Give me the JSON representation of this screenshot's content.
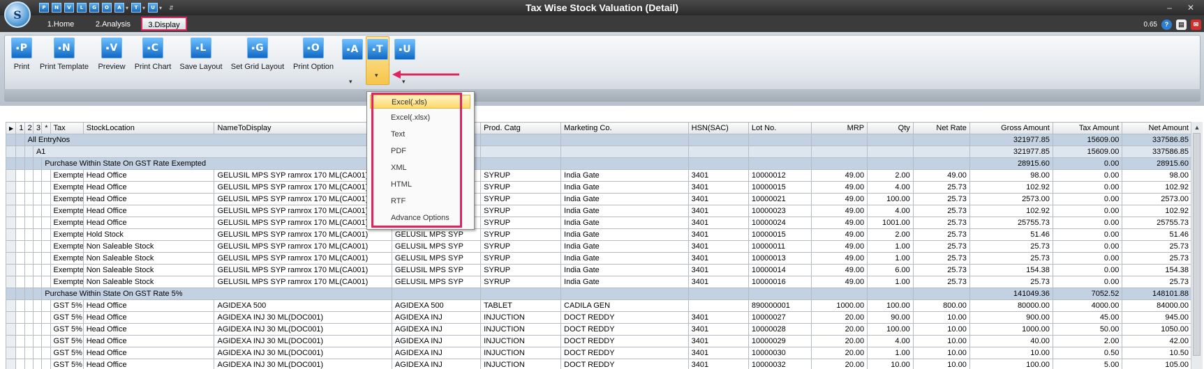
{
  "window": {
    "title": "Tax Wise Stock Valuation (Detail)"
  },
  "quick_access": [
    "P",
    "N",
    "V",
    "L",
    "G",
    "O",
    "A",
    "T",
    "U"
  ],
  "tabs": [
    {
      "label": "1.Home"
    },
    {
      "label": "2.Analysis"
    },
    {
      "label": "3.Display"
    }
  ],
  "status": {
    "zoom": "0.65"
  },
  "ribbon": {
    "buttons": [
      {
        "letter": "P",
        "label": "Print"
      },
      {
        "letter": "N",
        "label": "Print Template"
      },
      {
        "letter": "V",
        "label": "Preview"
      },
      {
        "letter": "C",
        "label": "Print Chart"
      },
      {
        "letter": "L",
        "label": "Save Layout"
      },
      {
        "letter": "G",
        "label": "Set Grid Layout"
      },
      {
        "letter": "O",
        "label": "Print Option"
      }
    ],
    "small_buttons": [
      {
        "letter": "A"
      },
      {
        "letter": "T"
      },
      {
        "letter": "U"
      }
    ]
  },
  "export_menu": {
    "items": [
      "Excel(.xls)",
      "Excel(.xlsx)",
      "Text",
      "PDF",
      "XML",
      "HTML",
      "RTF",
      "Advance Options"
    ]
  },
  "grid": {
    "headers": [
      "1",
      "2",
      "3",
      "*",
      "Tax",
      "StockLocation",
      "NameToDisplay",
      "",
      "Prod. Catg",
      "Marketing Co.",
      "HSN(SAC)",
      "Lot No.",
      "MRP",
      "Qty",
      "Net Rate",
      "Gross Amount",
      "Tax Amount",
      "Net Amount"
    ],
    "all_entry": {
      "label": "All EntryNos",
      "gross": "321977.85",
      "tax": "15609.00",
      "net": "337586.85"
    },
    "a1": {
      "label": "A1",
      "gross": "321977.85",
      "tax": "15609.00",
      "net": "337586.85"
    },
    "group1": {
      "label": "Purchase Within State On GST Rate Exempted",
      "gross": "28915.60",
      "tax": "0.00",
      "net": "28915.60"
    },
    "rows1": [
      [
        "Exempted",
        "Head Office",
        "GELUSIL MPS SYP ramrox 170 ML(CA001)",
        "GELUSIL MPS SYP",
        "SYRUP",
        "India Gate",
        "3401",
        "10000012",
        "49.00",
        "2.00",
        "49.00",
        "98.00",
        "0.00",
        "98.00"
      ],
      [
        "Exempted",
        "Head Office",
        "GELUSIL MPS SYP ramrox 170 ML(CA001)",
        "GELUSIL MPS SYP",
        "SYRUP",
        "India Gate",
        "3401",
        "10000015",
        "49.00",
        "4.00",
        "25.73",
        "102.92",
        "0.00",
        "102.92"
      ],
      [
        "Exempted",
        "Head Office",
        "GELUSIL MPS SYP ramrox 170 ML(CA001)",
        "GELUSIL MPS SYP",
        "SYRUP",
        "India Gate",
        "3401",
        "10000021",
        "49.00",
        "100.00",
        "25.73",
        "2573.00",
        "0.00",
        "2573.00"
      ],
      [
        "Exempted",
        "Head Office",
        "GELUSIL MPS SYP ramrox 170 ML(CA001)",
        "GELUSIL MPS SYP",
        "SYRUP",
        "India Gate",
        "3401",
        "10000023",
        "49.00",
        "4.00",
        "25.73",
        "102.92",
        "0.00",
        "102.92"
      ],
      [
        "Exempted",
        "Head Office",
        "GELUSIL MPS SYP ramrox 170 ML(CA001)",
        "GELUSIL MPS SYP",
        "SYRUP",
        "India Gate",
        "3401",
        "10000024",
        "49.00",
        "1001.00",
        "25.73",
        "25755.73",
        "0.00",
        "25755.73"
      ],
      [
        "Exempted",
        "Hold Stock",
        "GELUSIL MPS SYP ramrox 170 ML(CA001)",
        "GELUSIL MPS SYP",
        "SYRUP",
        "India Gate",
        "3401",
        "10000015",
        "49.00",
        "2.00",
        "25.73",
        "51.46",
        "0.00",
        "51.46"
      ],
      [
        "Exempted",
        "Non Saleable Stock",
        "GELUSIL MPS SYP ramrox 170 ML(CA001)",
        "GELUSIL MPS SYP",
        "SYRUP",
        "India Gate",
        "3401",
        "10000011",
        "49.00",
        "1.00",
        "25.73",
        "25.73",
        "0.00",
        "25.73"
      ],
      [
        "Exempted",
        "Non Saleable Stock",
        "GELUSIL MPS SYP ramrox 170 ML(CA001)",
        "GELUSIL MPS SYP",
        "SYRUP",
        "India Gate",
        "3401",
        "10000013",
        "49.00",
        "1.00",
        "25.73",
        "25.73",
        "0.00",
        "25.73"
      ],
      [
        "Exempted",
        "Non Saleable Stock",
        "GELUSIL MPS SYP ramrox 170 ML(CA001)",
        "GELUSIL MPS SYP",
        "SYRUP",
        "India Gate",
        "3401",
        "10000014",
        "49.00",
        "6.00",
        "25.73",
        "154.38",
        "0.00",
        "154.38"
      ],
      [
        "Exempted",
        "Non Saleable Stock",
        "GELUSIL MPS SYP ramrox 170 ML(CA001)",
        "GELUSIL MPS SYP",
        "SYRUP",
        "India Gate",
        "3401",
        "10000016",
        "49.00",
        "1.00",
        "25.73",
        "25.73",
        "0.00",
        "25.73"
      ]
    ],
    "group2": {
      "label": "Purchase Within State On GST Rate 5%",
      "gross": "141049.36",
      "tax": "7052.52",
      "net": "148101.88"
    },
    "rows2": [
      [
        "GST 5%",
        "Head Office",
        "AGIDEXA 500",
        "AGIDEXA 500",
        "TABLET",
        "CADILA GEN",
        "",
        "890000001",
        "1000.00",
        "100.00",
        "800.00",
        "80000.00",
        "4000.00",
        "84000.00"
      ],
      [
        "GST 5%",
        "Head Office",
        "AGIDEXA INJ 30 ML(DOC001)",
        "AGIDEXA INJ",
        "INJUCTION",
        "DOCT REDDY",
        "3401",
        "10000027",
        "20.00",
        "90.00",
        "10.00",
        "900.00",
        "45.00",
        "945.00"
      ],
      [
        "GST 5%",
        "Head Office",
        "AGIDEXA INJ 30 ML(DOC001)",
        "AGIDEXA INJ",
        "INJUCTION",
        "DOCT REDDY",
        "3401",
        "10000028",
        "20.00",
        "100.00",
        "10.00",
        "1000.00",
        "50.00",
        "1050.00"
      ],
      [
        "GST 5%",
        "Head Office",
        "AGIDEXA INJ 30 ML(DOC001)",
        "AGIDEXA INJ",
        "INJUCTION",
        "DOCT REDDY",
        "3401",
        "10000029",
        "20.00",
        "4.00",
        "10.00",
        "40.00",
        "2.00",
        "42.00"
      ],
      [
        "GST 5%",
        "Head Office",
        "AGIDEXA INJ 30 ML(DOC001)",
        "AGIDEXA INJ",
        "INJUCTION",
        "DOCT REDDY",
        "3401",
        "10000030",
        "20.00",
        "1.00",
        "10.00",
        "10.00",
        "0.50",
        "10.50"
      ],
      [
        "GST 5%",
        "Head Office",
        "AGIDEXA INJ 30 ML(DOC001)",
        "AGIDEXA INJ",
        "INJUCTION",
        "DOCT REDDY",
        "3401",
        "10000032",
        "20.00",
        "10.00",
        "10.00",
        "100.00",
        "5.00",
        "105.00"
      ]
    ]
  },
  "colors": {
    "highlight": "#e0245e",
    "group_row": "#c3d2e3",
    "accent": "#1168c4"
  }
}
